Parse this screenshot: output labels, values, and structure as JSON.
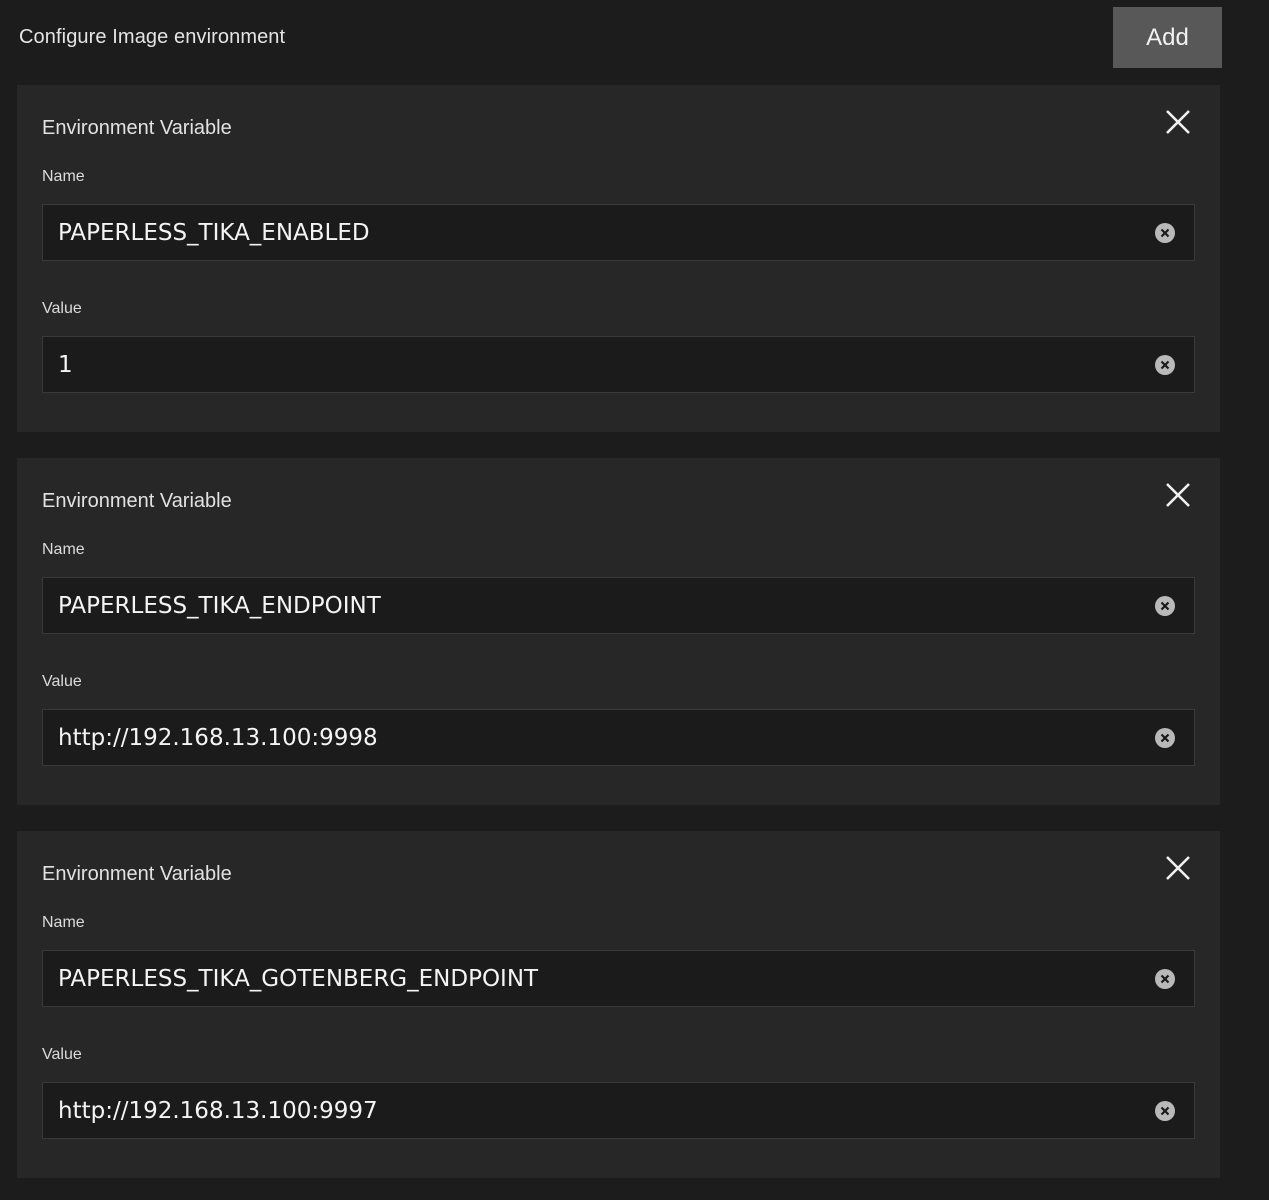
{
  "header": {
    "title": "Configure Image environment",
    "add_label": "Add"
  },
  "variables": [
    {
      "title": "Environment Variable",
      "name_label": "Name",
      "name_value": "PAPERLESS_TIKA_ENABLED",
      "value_label": "Value",
      "value_value": "1"
    },
    {
      "title": "Environment Variable",
      "name_label": "Name",
      "name_value": "PAPERLESS_TIKA_ENDPOINT",
      "value_label": "Value",
      "value_value": "http://192.168.13.100:9998"
    },
    {
      "title": "Environment Variable",
      "name_label": "Name",
      "name_value": "PAPERLESS_TIKA_GOTENBERG_ENDPOINT",
      "value_label": "Value",
      "value_value": "http://192.168.13.100:9997"
    }
  ],
  "icons": {
    "remove": "close-icon",
    "clear": "clear-circle-icon"
  },
  "colors": {
    "background": "#1c1c1c",
    "card": "#272727",
    "input": "#1b1b1b",
    "button": "#585858"
  }
}
